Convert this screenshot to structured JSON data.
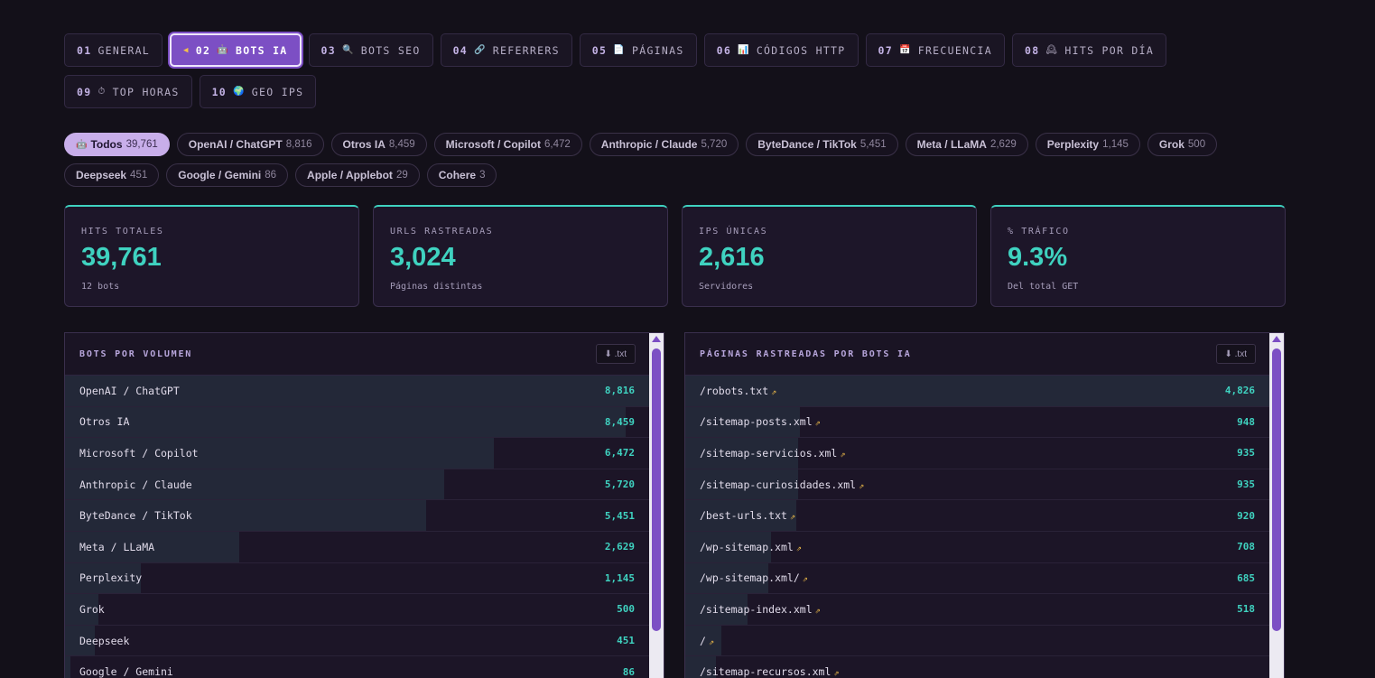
{
  "tabs": [
    {
      "num": "01",
      "icon": "",
      "label": "GENERAL",
      "active": false
    },
    {
      "num": "02",
      "icon": "🤖",
      "label": "BOTS IA",
      "active": true
    },
    {
      "num": "03",
      "icon": "🔍",
      "label": "BOTS SEO",
      "active": false
    },
    {
      "num": "04",
      "icon": "🔗",
      "label": "REFERRERS",
      "active": false
    },
    {
      "num": "05",
      "icon": "📄",
      "label": "PÁGINAS",
      "active": false
    },
    {
      "num": "06",
      "icon": "📊",
      "label": "CÓDIGOS HTTP",
      "active": false
    },
    {
      "num": "07",
      "icon": "📅",
      "label": "FRECUENCIA",
      "active": false
    },
    {
      "num": "08",
      "icon": "🕰",
      "label": "HITS POR DÍA",
      "active": false
    },
    {
      "num": "09",
      "icon": "⏱",
      "label": "TOP HORAS",
      "active": false
    },
    {
      "num": "10",
      "icon": "🌍",
      "label": "GEO IPS",
      "active": false
    }
  ],
  "filters": [
    {
      "icon": "🤖",
      "label": "Todos",
      "count": "39,761",
      "active": true
    },
    {
      "label": "OpenAI / ChatGPT",
      "count": "8,816"
    },
    {
      "label": "Otros IA",
      "count": "8,459"
    },
    {
      "label": "Microsoft / Copilot",
      "count": "6,472"
    },
    {
      "label": "Anthropic / Claude",
      "count": "5,720"
    },
    {
      "label": "ByteDance / TikTok",
      "count": "5,451"
    },
    {
      "label": "Meta / LLaMA",
      "count": "2,629"
    },
    {
      "label": "Perplexity",
      "count": "1,145"
    },
    {
      "label": "Grok",
      "count": "500"
    },
    {
      "label": "Deepseek",
      "count": "451"
    },
    {
      "label": "Google / Gemini",
      "count": "86"
    },
    {
      "label": "Apple / Applebot",
      "count": "29"
    },
    {
      "label": "Cohere",
      "count": "3"
    }
  ],
  "stats": [
    {
      "label": "HITS TOTALES",
      "value": "39,761",
      "sub": "12 bots"
    },
    {
      "label": "URLS RASTREADAS",
      "value": "3,024",
      "sub": "Páginas distintas"
    },
    {
      "label": "IPS ÚNICAS",
      "value": "2,616",
      "sub": "Servidores"
    },
    {
      "label": "% TRÁFICO",
      "value": "9.3%",
      "sub": "Del total GET"
    }
  ],
  "panels": {
    "bots": {
      "title": "BOTS POR VOLUMEN",
      "download_label": "⬇ .txt",
      "max": 8816,
      "rows": [
        {
          "name": "OpenAI / ChatGPT",
          "value": 8816,
          "display": "8,816"
        },
        {
          "name": "Otros IA",
          "value": 8459,
          "display": "8,459"
        },
        {
          "name": "Microsoft / Copilot",
          "value": 6472,
          "display": "6,472"
        },
        {
          "name": "Anthropic / Claude",
          "value": 5720,
          "display": "5,720"
        },
        {
          "name": "ByteDance / TikTok",
          "value": 5451,
          "display": "5,451"
        },
        {
          "name": "Meta / LLaMA",
          "value": 2629,
          "display": "2,629"
        },
        {
          "name": "Perplexity",
          "value": 1145,
          "display": "1,145"
        },
        {
          "name": "Grok",
          "value": 500,
          "display": "500"
        },
        {
          "name": "Deepseek",
          "value": 451,
          "display": "451"
        },
        {
          "name": "Google / Gemini",
          "value": 86,
          "display": "86"
        }
      ]
    },
    "pages": {
      "title": "PÁGINAS RASTREADAS POR BOTS IA",
      "download_label": "⬇ .txt",
      "max": 4826,
      "rows": [
        {
          "name": "/robots.txt",
          "value": 4826,
          "display": "4,826"
        },
        {
          "name": "/sitemap-posts.xml",
          "value": 948,
          "display": "948"
        },
        {
          "name": "/sitemap-servicios.xml",
          "value": 935,
          "display": "935"
        },
        {
          "name": "/sitemap-curiosidades.xml",
          "value": 935,
          "display": "935"
        },
        {
          "name": "/best-urls.txt",
          "value": 920,
          "display": "920"
        },
        {
          "name": "/wp-sitemap.xml",
          "value": 708,
          "display": "708"
        },
        {
          "name": "/wp-sitemap.xml/",
          "value": 685,
          "display": "685"
        },
        {
          "name": "/sitemap-index.xml",
          "value": 518,
          "display": "518"
        },
        {
          "name": "/",
          "value": 300,
          "display": ""
        },
        {
          "name": "/sitemap-recursos.xml",
          "value": 250,
          "display": ""
        }
      ]
    }
  },
  "colors": {
    "accent": "#3fd2c0",
    "active_tab": "#7c4fc4",
    "link_icon": "#f5c04a"
  }
}
